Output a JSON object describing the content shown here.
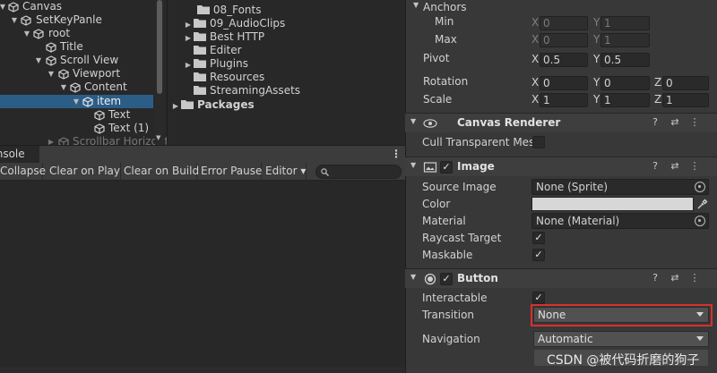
{
  "hierarchy": {
    "items": [
      {
        "label": "Canvas"
      },
      {
        "label": "SetKeyPanle"
      },
      {
        "label": "root"
      },
      {
        "label": "Title"
      },
      {
        "label": "Scroll View"
      },
      {
        "label": "Viewport"
      },
      {
        "label": "Content"
      },
      {
        "label": "item"
      },
      {
        "label": "Text"
      },
      {
        "label": "Text (1)"
      },
      {
        "label": "Scrollbar Horizontal"
      }
    ]
  },
  "project": {
    "items": [
      {
        "label": "08_Fonts"
      },
      {
        "label": "09_AudioClips"
      },
      {
        "label": "Best HTTP"
      },
      {
        "label": "Editer"
      },
      {
        "label": "Plugins"
      },
      {
        "label": "Resources"
      },
      {
        "label": "StreamingAssets"
      },
      {
        "label": "Packages"
      }
    ]
  },
  "console": {
    "tab_label": "Console",
    "buttons": [
      "Collapse",
      "Clear on Play",
      "Clear on Build",
      "Error Pause",
      "Editor ▾"
    ],
    "search_icon": "🔍"
  },
  "inspector": {
    "anchors": {
      "title": "Anchors",
      "min_label": "Min",
      "max_label": "Max",
      "min": {
        "x": "0",
        "y": "1"
      },
      "max": {
        "x": "0",
        "y": "1"
      }
    },
    "pivot": {
      "label": "Pivot",
      "x": "0.5",
      "y": "0.5"
    },
    "rotation": {
      "label": "Rotation",
      "x": "0",
      "y": "0",
      "z": "0"
    },
    "scale": {
      "label": "Scale",
      "x": "1",
      "y": "1",
      "z": "1"
    },
    "axis": {
      "x": "X",
      "y": "Y",
      "z": "Z"
    },
    "canvas_renderer": {
      "title": "Canvas Renderer",
      "cull_label": "Cull Transparent Mesh"
    },
    "image": {
      "title": "Image",
      "source_label": "Source Image",
      "source_value": "None (Sprite)",
      "color_label": "Color",
      "color_value": "#d7d7d7",
      "material_label": "Material",
      "material_value": "None (Material)",
      "raycast_label": "Raycast Target",
      "maskable_label": "Maskable"
    },
    "button": {
      "title": "Button",
      "interactable_label": "Interactable",
      "transition_label": "Transition",
      "transition_value": "None",
      "navigation_label": "Navigation",
      "navigation_value": "Automatic"
    },
    "header_icons": {
      "help": "?",
      "presets": "⇄",
      "menu": "⋮"
    }
  },
  "watermark": "CSDN @被代码折磨的狗子",
  "colors": {
    "panel_bg": "#282828",
    "inspector_bg": "#383838",
    "selection": "#2c5d87",
    "highlight": "#d8302d"
  }
}
